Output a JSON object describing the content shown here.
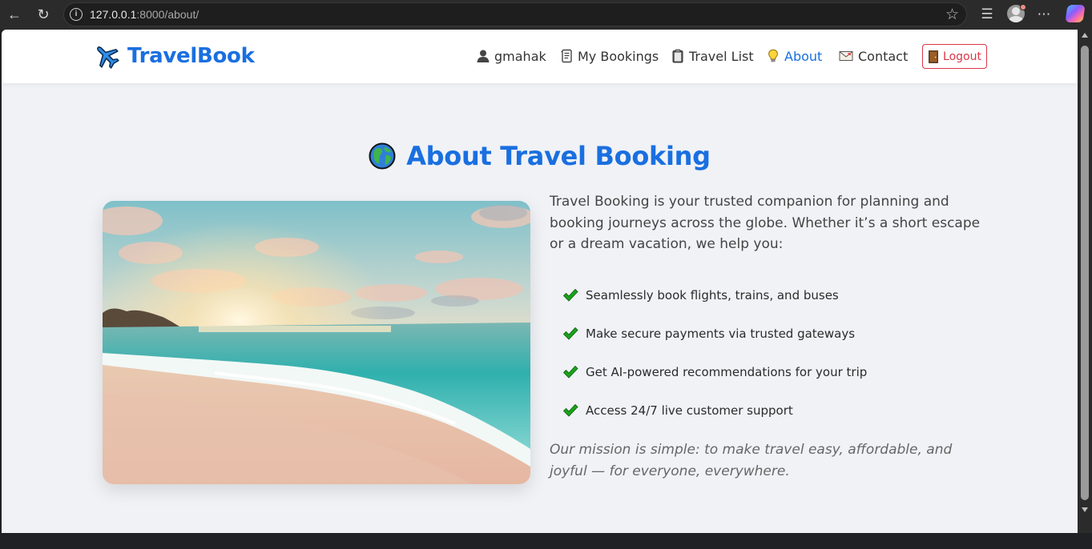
{
  "browser": {
    "url_host": "127.0.0.1",
    "url_path": ":8000/about/"
  },
  "navbar": {
    "brand": "TravelBook",
    "items": [
      {
        "label": "gmahak",
        "icon": "user-icon"
      },
      {
        "label": "My Bookings",
        "icon": "scroll-icon"
      },
      {
        "label": "Travel List",
        "icon": "clipboard-icon"
      },
      {
        "label": "About",
        "icon": "lightbulb-icon",
        "active": true
      },
      {
        "label": "Contact",
        "icon": "envelope-icon"
      }
    ],
    "logout": "Logout"
  },
  "main": {
    "heading": "About Travel Booking",
    "intro": "Travel Booking is your trusted companion for planning and booking journeys across the globe. Whether it’s a short escape or a dream vacation, we help you:",
    "features": [
      "Seamlessly book flights, trains, and buses",
      "Make secure payments via trusted gateways",
      "Get AI-powered recommendations for your trip",
      "Access 24/7 live customer support"
    ],
    "mission": "Our mission is simple: to make travel easy, affordable, and joyful — for everyone, everywhere."
  },
  "colors": {
    "brand": "#1a6fe0",
    "logout": "#dc3545",
    "check": "#1aa31a",
    "page_bg": "#f0f2f6"
  }
}
